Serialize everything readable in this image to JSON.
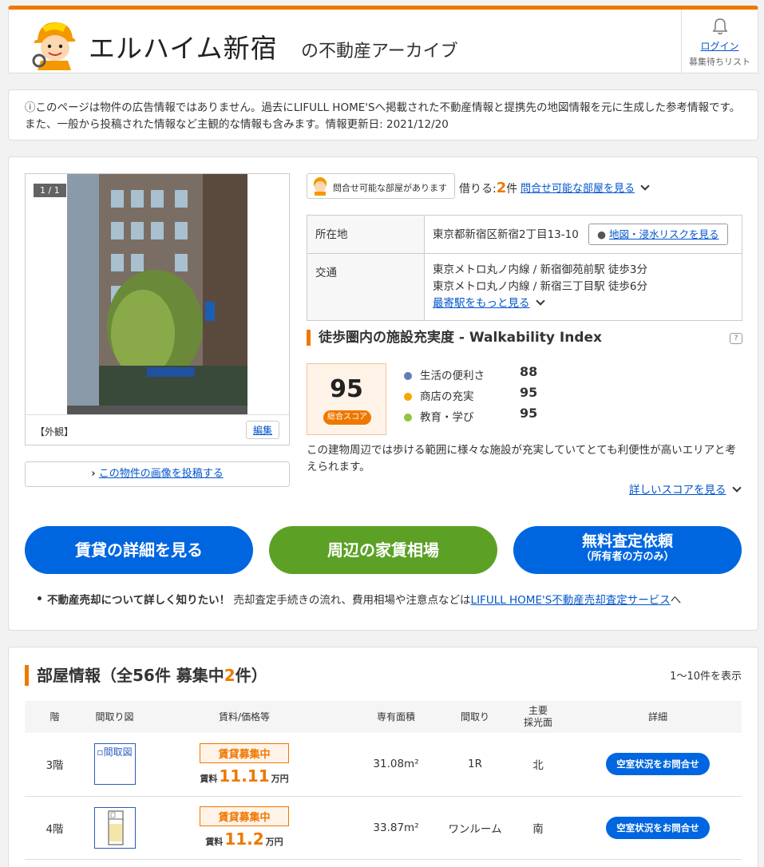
{
  "header": {
    "title": "エルハイム新宿",
    "subtitle": "の不動産アーカイブ",
    "login_label": "ログイン",
    "waitlist_label": "募集待ちリスト"
  },
  "notice": {
    "text": "ⓘこのページは物件の広告情報ではありません。過去にLIFULL HOME'Sへ掲載された不動産情報と提携先の地図情報を元に生成した参考情報です。また、一般から投稿された情報など主観的な情報も含みます。情報更新日: 2021/12/20"
  },
  "photo": {
    "counter": "1 / 1",
    "caption": "【外観】",
    "edit_label": "編集",
    "post_label": "この物件の画像を投稿する"
  },
  "inquiry": {
    "badge_label": "問合せ可能な部屋があります",
    "rent_prefix": "借りる:",
    "rent_count": "2",
    "rent_suffix": "件",
    "link_label": "問合せ可能な部屋を見る"
  },
  "info": {
    "address_label": "所在地",
    "address": "東京都新宿区新宿2丁目13-10",
    "map_button": "地図・浸水リスクを見る",
    "transit_label": "交通",
    "transit_1": "東京メトロ丸ノ内線 / 新宿御苑前駅 徒歩3分",
    "transit_2": "東京メトロ丸ノ内線 / 新宿三丁目駅 徒歩6分",
    "more_stations": "最寄駅をもっと見る"
  },
  "walkability": {
    "title": "徒歩圏内の施設充実度 - Walkability Index",
    "help": "?",
    "total_score": "95",
    "total_label": "総合スコア",
    "items": [
      {
        "label": "生活の便利さ",
        "value": "88",
        "color": "#5b7fb5"
      },
      {
        "label": "商店の充実",
        "value": "95",
        "color": "#f5a800"
      },
      {
        "label": "教育・学び",
        "value": "95",
        "color": "#8cc63f"
      }
    ],
    "description": "この建物周辺では歩ける範囲に様々な施設が充実していてとても利便性が高いエリアと考えられます。",
    "more_label": "詳しいスコアを見る"
  },
  "cta": {
    "rent_detail": "賃貸の詳細を見る",
    "market": "周辺の家賃相場",
    "assess": "無料査定依頼",
    "assess_sub": "（所有者の方のみ）"
  },
  "sell_note": {
    "bold": "不動産売却について詳しく知りたい！",
    "text": "売却査定手続きの流れ、費用相場や注意点などは",
    "link": "LIFULL HOME'S不動産売却査定サービス",
    "suffix": "へ"
  },
  "rooms": {
    "title_prefix": "部屋情報（全56件 募集中",
    "title_count": "2",
    "title_suffix": "件）",
    "range": "1〜10件を表示",
    "headers": {
      "floor": "階",
      "floorplan": "間取り図",
      "rent": "賃料/価格等",
      "area": "専有面積",
      "layout": "間取り",
      "facing_1": "主要",
      "facing_2": "採光面",
      "detail": "詳細"
    },
    "rows": [
      {
        "floor": "3階",
        "plan_alt": "間取図",
        "status": "賃貸募集中",
        "price_label": "賃料",
        "price": "11.11",
        "unit": "万円",
        "area": "31.08m²",
        "layout": "1R",
        "facing": "北",
        "button": "空室状況をお問合せ"
      },
      {
        "floor": "4階",
        "plan_alt": "",
        "status": "賃貸募集中",
        "price_label": "賃料",
        "price": "11.2",
        "unit": "万円",
        "area": "33.87m²",
        "layout": "ワンルーム",
        "facing": "南",
        "button": "空室状況をお問合せ"
      }
    ]
  }
}
